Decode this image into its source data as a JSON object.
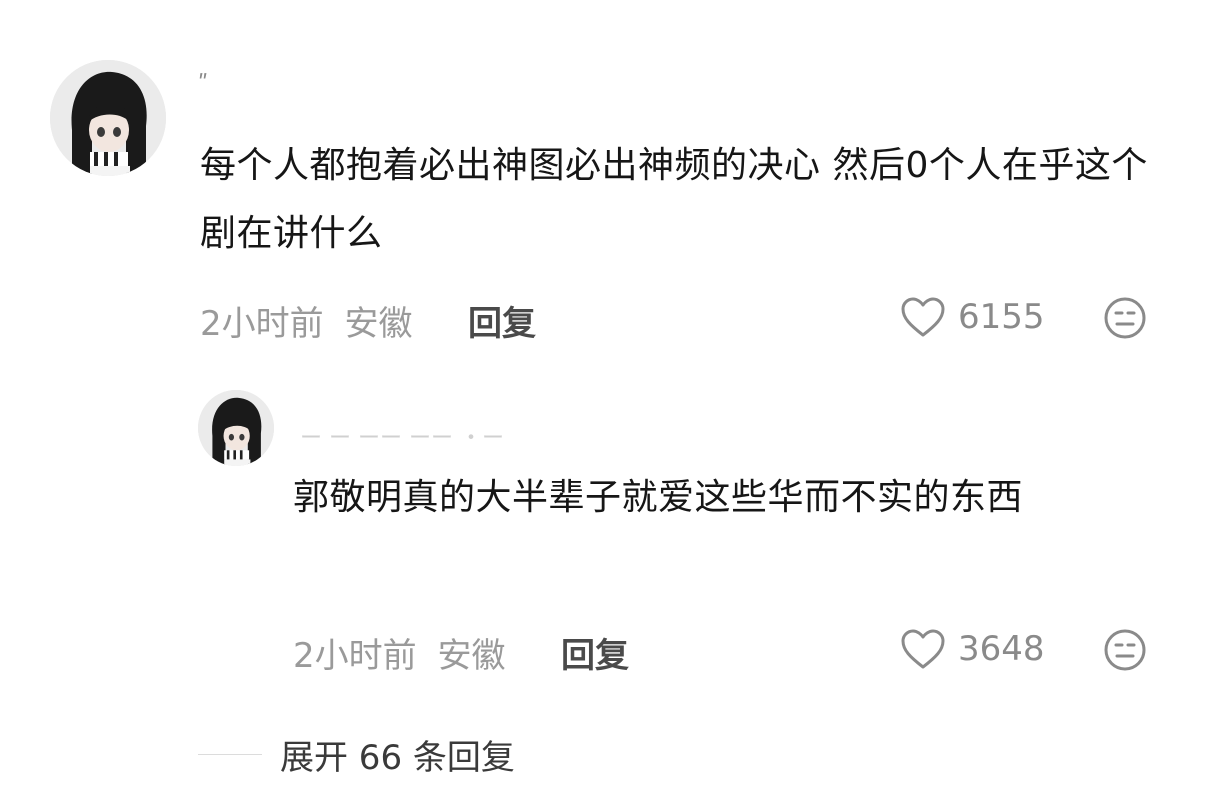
{
  "comments": [
    {
      "username": "ʺ",
      "text": "每个人都抱着必出神图必出神频的决心 然后0个人在乎这个剧在讲什么",
      "time": "2小时前",
      "location": "安徽",
      "reply_label": "回复",
      "likes": "6155",
      "like_icon": "heart-outline-icon",
      "dislike_icon": "meh-face-icon"
    }
  ],
  "replies": [
    {
      "username": "ー ー ーー ーー ・ー",
      "text": "郭敬明真的大半辈子就爱这些华而不实的东西",
      "time": "2小时前",
      "location": "安徽",
      "reply_label": "回复",
      "likes": "3648",
      "like_icon": "heart-outline-icon",
      "dislike_icon": "meh-face-icon"
    }
  ],
  "expand": {
    "label": "展开 66 条回复"
  },
  "colors": {
    "text_primary": "#161616",
    "text_meta": "#9a9a9a",
    "reply_button": "#4a4a4a",
    "icon": "#8a8a8a"
  }
}
